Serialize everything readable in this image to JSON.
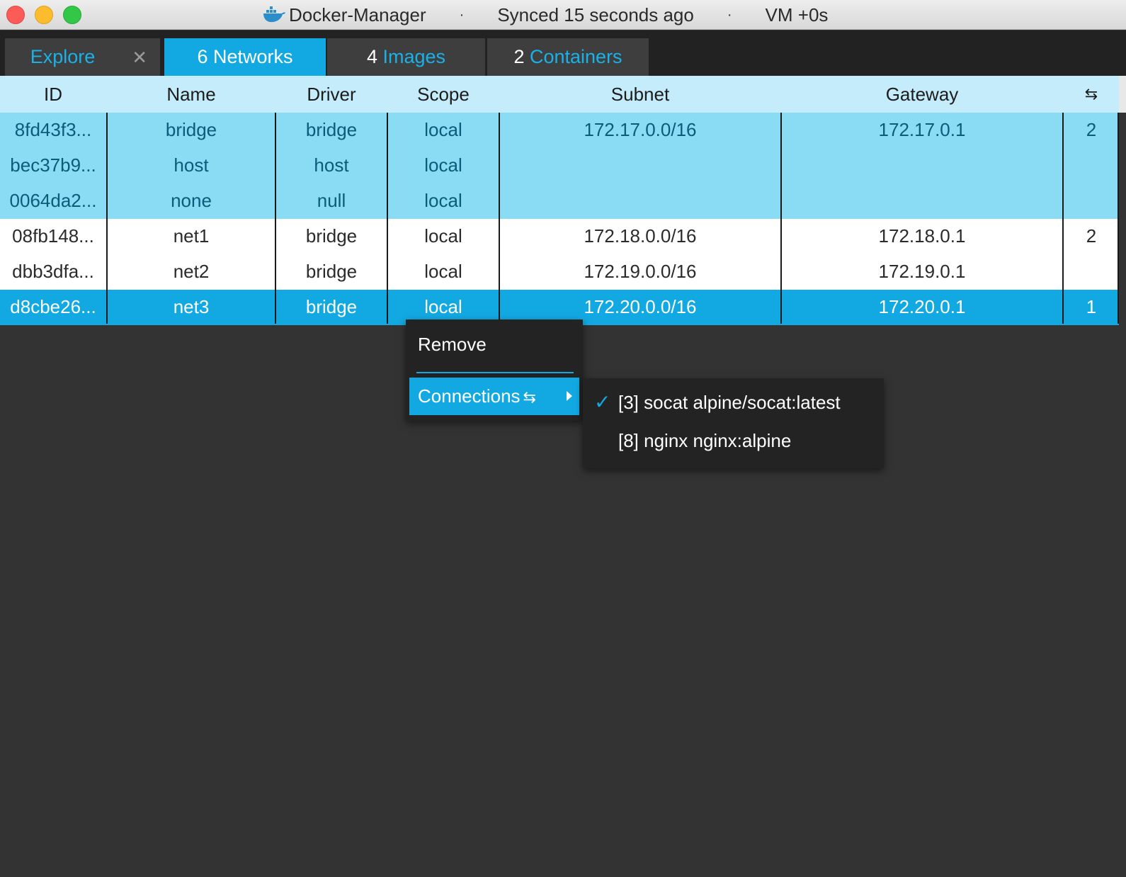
{
  "window": {
    "app_name": "Docker-Manager",
    "separator": "·",
    "sync_status": "Synced 15 seconds ago",
    "vm_status": "VM +0s",
    "icon": "docker-whale-icon"
  },
  "tabs": [
    {
      "count": "",
      "label": "Explore",
      "close": "✕"
    },
    {
      "count": "6",
      "label": "Networks"
    },
    {
      "count": "4",
      "label": "Images"
    },
    {
      "count": "2",
      "label": "Containers"
    }
  ],
  "table": {
    "columns": [
      "ID",
      "Name",
      "Driver",
      "Scope",
      "Subnet",
      "Gateway",
      "⇆"
    ],
    "rows": [
      {
        "id": "8fd43f3...",
        "name": "bridge",
        "driver": "bridge",
        "scope": "local",
        "subnet": "172.17.0.0/16",
        "gateway": "172.17.0.1",
        "conn": "2"
      },
      {
        "id": "bec37b9...",
        "name": "host",
        "driver": "host",
        "scope": "local",
        "subnet": "",
        "gateway": "",
        "conn": ""
      },
      {
        "id": "0064da2...",
        "name": "none",
        "driver": "null",
        "scope": "local",
        "subnet": "",
        "gateway": "",
        "conn": ""
      },
      {
        "id": "08fb148...",
        "name": "net1",
        "driver": "bridge",
        "scope": "local",
        "subnet": "172.18.0.0/16",
        "gateway": "172.18.0.1",
        "conn": "2"
      },
      {
        "id": "dbb3dfa...",
        "name": "net2",
        "driver": "bridge",
        "scope": "local",
        "subnet": "172.19.0.0/16",
        "gateway": "172.19.0.1",
        "conn": ""
      },
      {
        "id": "d8cbe26...",
        "name": "net3",
        "driver": "bridge",
        "scope": "local",
        "subnet": "172.20.0.0/16",
        "gateway": "172.20.0.1",
        "conn": "1"
      }
    ]
  },
  "context_menu": {
    "remove_label": "Remove",
    "connections_label": "Connections",
    "connections_icon": "⇆"
  },
  "submenu": {
    "items": [
      {
        "label": "[3] socat alpine/socat:latest",
        "checked": true,
        "check_glyph": "✓"
      },
      {
        "label": "[8] nginx nginx:alpine",
        "checked": false
      }
    ]
  },
  "colors": {
    "accent": "#12a9e2",
    "system_row": "#8adcf5",
    "header_bg": "#c4ecfa",
    "background": "#333333"
  }
}
